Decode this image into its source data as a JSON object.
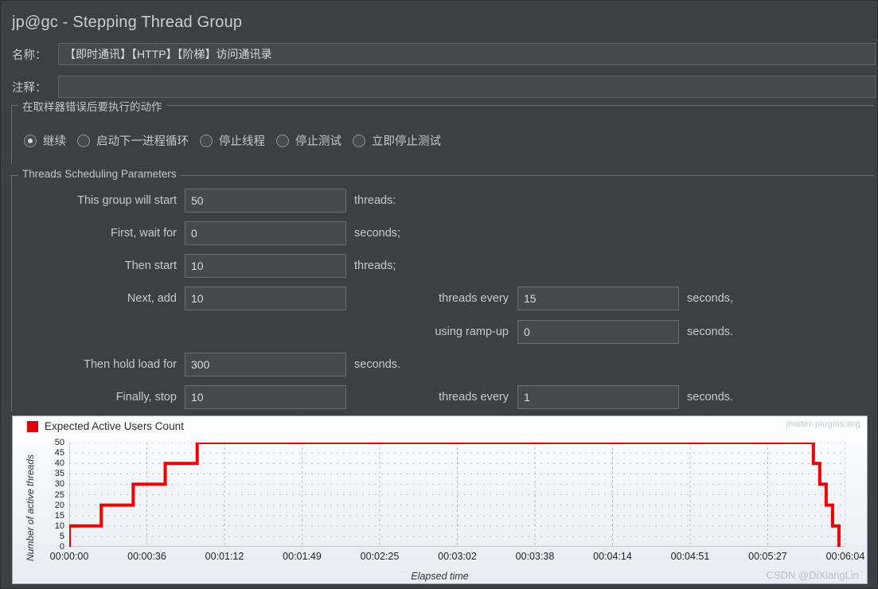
{
  "panel": {
    "title": "jp@gc - Stepping Thread Group"
  },
  "fields": {
    "name_label": "名称：",
    "name_value": "【即时通讯】【HTTP】【阶梯】访问通讯录",
    "comment_label": "注释：",
    "comment_value": ""
  },
  "error_action": {
    "legend": "在取样器错误后要执行的动作",
    "options": [
      {
        "label": "继续",
        "selected": true
      },
      {
        "label": "启动下一进程循环",
        "selected": false
      },
      {
        "label": "停止线程",
        "selected": false
      },
      {
        "label": "停止测试",
        "selected": false
      },
      {
        "label": "立即停止测试",
        "selected": false
      }
    ]
  },
  "scheduling": {
    "legend": "Threads Scheduling Parameters",
    "rows": [
      {
        "label": "This group will start",
        "value": "50",
        "unit": "threads:"
      },
      {
        "label": "First, wait for",
        "value": "0",
        "unit": "seconds;"
      },
      {
        "label": "Then start",
        "value": "10",
        "unit": "threads;"
      },
      {
        "label": "Next, add",
        "value": "10",
        "mid": "threads every",
        "value2": "15",
        "unit2": "seconds,"
      },
      {
        "label": "",
        "mid": "using ramp-up",
        "value2": "0",
        "unit2": "seconds."
      },
      {
        "label": "Then hold load for",
        "value": "300",
        "unit": "seconds."
      },
      {
        "label": "Finally, stop",
        "value": "10",
        "mid": "threads every",
        "value2": "1",
        "unit2": "seconds."
      }
    ]
  },
  "chart_data": {
    "type": "line",
    "title": "Expected Active Users Count",
    "watermark": "jmeter-plugins.org",
    "credit": "CSDN @DiXiangLin",
    "xlabel": "Elapsed time",
    "ylabel": "Number of active threads",
    "ylim": [
      0,
      50
    ],
    "yticks": [
      50,
      45,
      40,
      35,
      30,
      25,
      20,
      15,
      10,
      5,
      0
    ],
    "xticks": [
      "00:00:00",
      "00:00:36",
      "00:01:12",
      "00:01:49",
      "00:02:25",
      "00:03:02",
      "00:03:38",
      "00:04:14",
      "00:04:51",
      "00:05:27",
      "00:06:04"
    ],
    "xlim_seconds": [
      0,
      364
    ],
    "grid": true,
    "legend_position": "top-left",
    "series": [
      {
        "name": "Expected Active Users Count",
        "color": "#ee0000",
        "points": [
          {
            "t": 0,
            "v": 0
          },
          {
            "t": 0,
            "v": 10
          },
          {
            "t": 15,
            "v": 10
          },
          {
            "t": 15,
            "v": 20
          },
          {
            "t": 30,
            "v": 20
          },
          {
            "t": 30,
            "v": 30
          },
          {
            "t": 45,
            "v": 30
          },
          {
            "t": 45,
            "v": 40
          },
          {
            "t": 60,
            "v": 40
          },
          {
            "t": 60,
            "v": 50
          },
          {
            "t": 349,
            "v": 50
          },
          {
            "t": 349,
            "v": 40
          },
          {
            "t": 352,
            "v": 40
          },
          {
            "t": 352,
            "v": 30
          },
          {
            "t": 355,
            "v": 30
          },
          {
            "t": 355,
            "v": 20
          },
          {
            "t": 358,
            "v": 20
          },
          {
            "t": 358,
            "v": 10
          },
          {
            "t": 361,
            "v": 10
          },
          {
            "t": 361,
            "v": 0
          }
        ]
      }
    ]
  }
}
